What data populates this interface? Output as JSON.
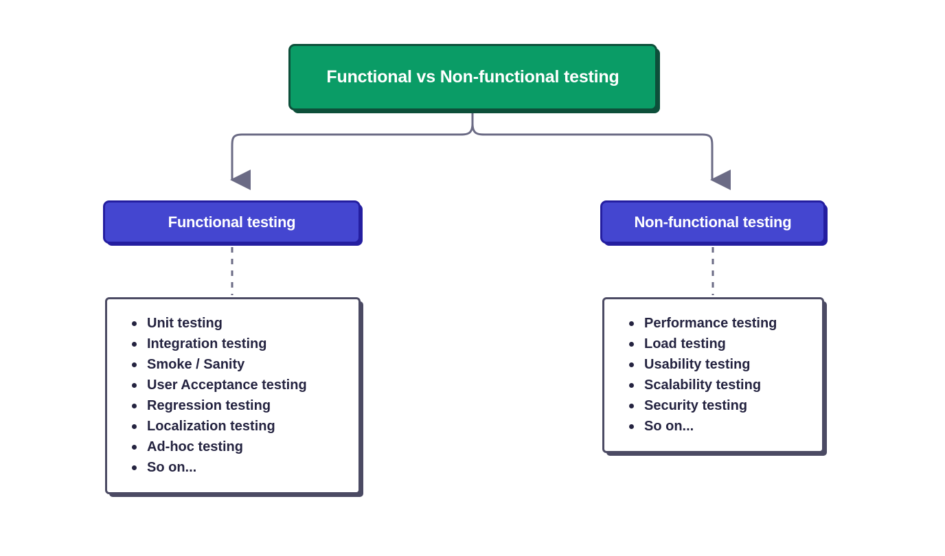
{
  "diagram": {
    "title": "Functional vs Non-functional testing",
    "colors": {
      "root_fill": "#0a9c66",
      "root_border": "#0d4f3a",
      "branch_fill": "#4446d0",
      "branch_border": "#241ea0",
      "list_border": "#4b4a63",
      "connector": "#6b6b85",
      "text_dark": "#242340",
      "text_light": "#ffffff",
      "background": "#ffffff"
    },
    "root": {
      "label": "Functional vs Non-functional testing"
    },
    "branches": [
      {
        "label": "Functional testing",
        "items": [
          "Unit testing",
          "Integration testing",
          "Smoke / Sanity",
          "User Acceptance testing",
          "Regression testing",
          "Localization testing",
          "Ad-hoc testing",
          "So on..."
        ]
      },
      {
        "label": "Non-functional testing",
        "items": [
          "Performance testing",
          "Load testing",
          "Usability testing",
          "Scalability testing",
          "Security testing",
          "So on..."
        ]
      }
    ]
  }
}
